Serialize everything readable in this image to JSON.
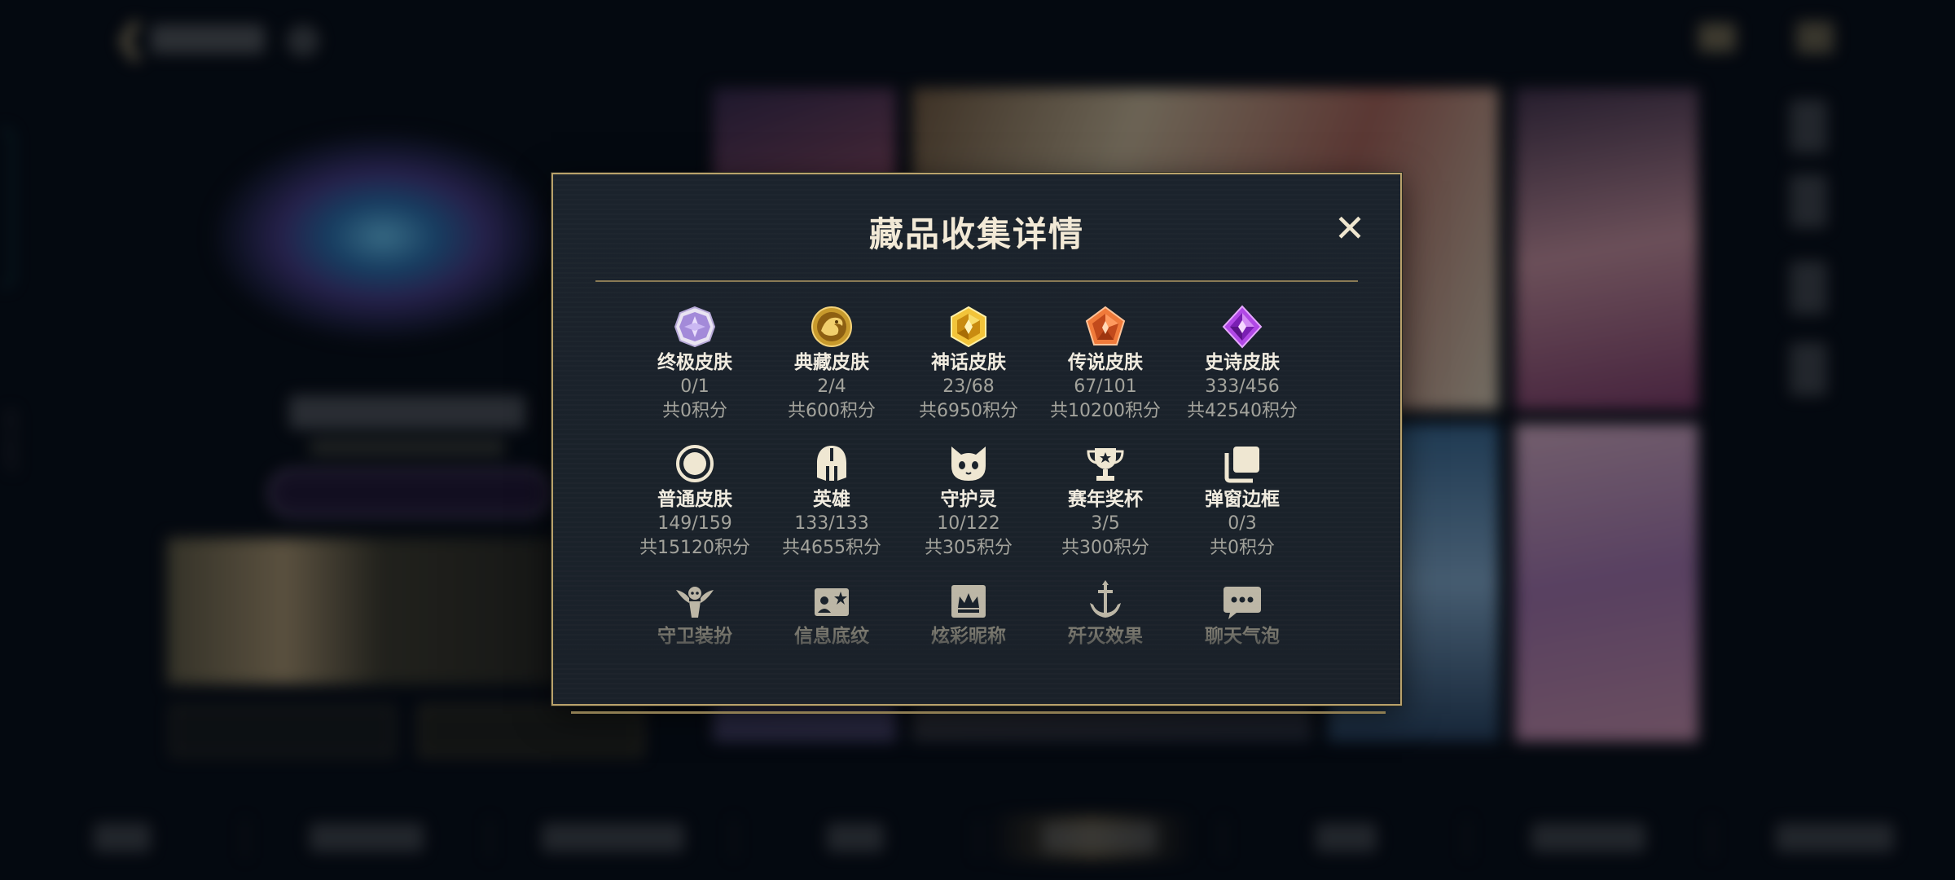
{
  "dialog": {
    "title": "藏品收集详情",
    "close_icon": "close-icon"
  },
  "collection_items": [
    {
      "name": "终极皮肤",
      "count": "0/1",
      "points": "共0积分",
      "icon": "ultimate-skin-icon"
    },
    {
      "name": "典藏皮肤",
      "count": "2/4",
      "points": "共600积分",
      "icon": "collector-skin-icon"
    },
    {
      "name": "神话皮肤",
      "count": "23/68",
      "points": "共6950积分",
      "icon": "mythic-skin-icon"
    },
    {
      "name": "传说皮肤",
      "count": "67/101",
      "points": "共10200积分",
      "icon": "legendary-skin-icon"
    },
    {
      "name": "史诗皮肤",
      "count": "333/456",
      "points": "共42540积分",
      "icon": "epic-skin-icon"
    },
    {
      "name": "普通皮肤",
      "count": "149/159",
      "points": "共15120积分",
      "icon": "normal-skin-icon"
    },
    {
      "name": "英雄",
      "count": "133/133",
      "points": "共4655积分",
      "icon": "hero-helmet-icon"
    },
    {
      "name": "守护灵",
      "count": "10/122",
      "points": "共305积分",
      "icon": "guardian-spirit-icon"
    },
    {
      "name": "赛年奖杯",
      "count": "3/5",
      "points": "共300积分",
      "icon": "trophy-icon"
    },
    {
      "name": "弹窗边框",
      "count": "0/3",
      "points": "共0积分",
      "icon": "popup-frame-icon"
    },
    {
      "name": "守卫装扮",
      "icon": "guard-outfit-icon"
    },
    {
      "name": "信息底纹",
      "icon": "info-background-icon"
    },
    {
      "name": "炫彩昵称",
      "icon": "colorful-nickname-icon"
    },
    {
      "name": "歼灭效果",
      "icon": "annihilation-effect-icon"
    },
    {
      "name": "聊天气泡",
      "icon": "chat-bubble-icon"
    }
  ],
  "background": {
    "vertical_id": "3672447"
  },
  "colors": {
    "gold_border": "#b9a26b",
    "panel_bg": "#1b232c",
    "title_text": "#f2e9d6",
    "secondary_text": "#a3a39c"
  }
}
